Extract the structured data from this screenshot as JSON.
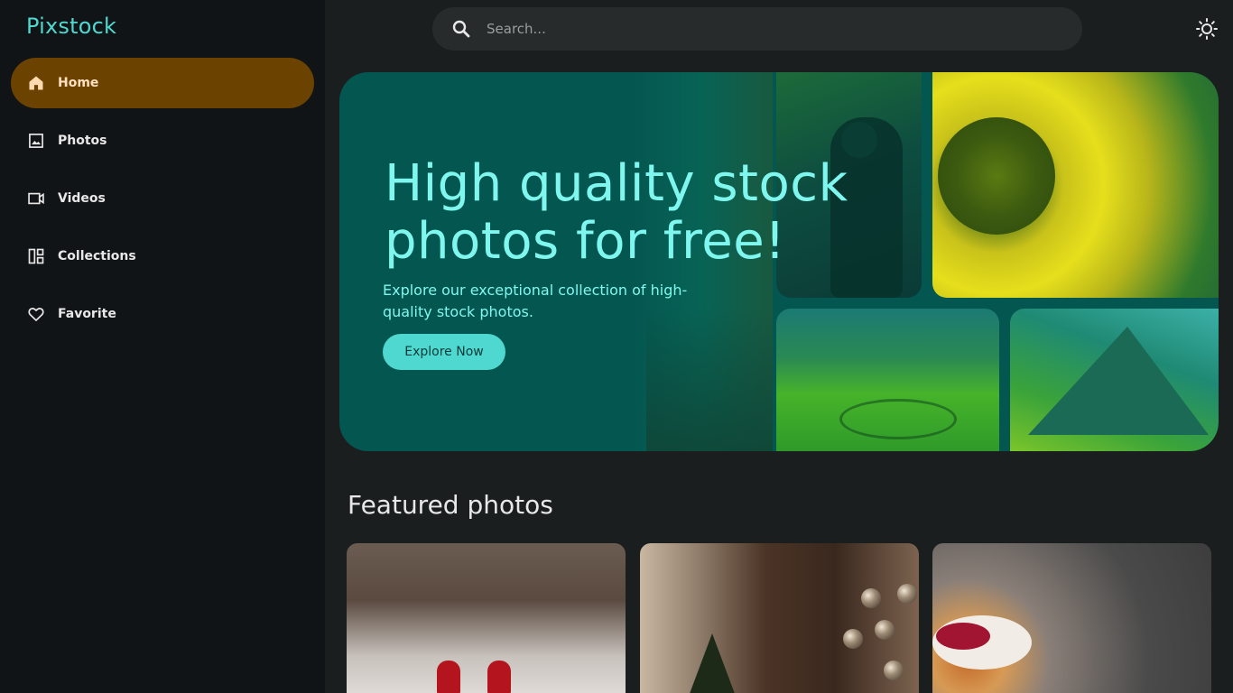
{
  "app": {
    "logo": "Pixstock"
  },
  "sidebar": {
    "items": [
      {
        "label": "Home",
        "icon": "home-icon",
        "active": true
      },
      {
        "label": "Photos",
        "icon": "image-icon",
        "active": false
      },
      {
        "label": "Videos",
        "icon": "video-icon",
        "active": false
      },
      {
        "label": "Collections",
        "icon": "collections-icon",
        "active": false
      },
      {
        "label": "Favorite",
        "icon": "heart-icon",
        "active": false
      }
    ]
  },
  "search": {
    "placeholder": "Search...",
    "value": "",
    "icon": "search-icon"
  },
  "header": {
    "theme_icon": "sun-icon"
  },
  "hero": {
    "title": "High quality stock photos for free!",
    "subtitle": "Explore our exceptional collection of high-quality stock photos.",
    "button_label": "Explore Now"
  },
  "featured": {
    "title": "Featured photos"
  },
  "colors": {
    "accent": "#4fd8cf",
    "active_nav_bg": "#6b4200",
    "hero_bg": "#045650",
    "page_bg": "#1b1e1f",
    "sidebar_bg": "#101416"
  }
}
